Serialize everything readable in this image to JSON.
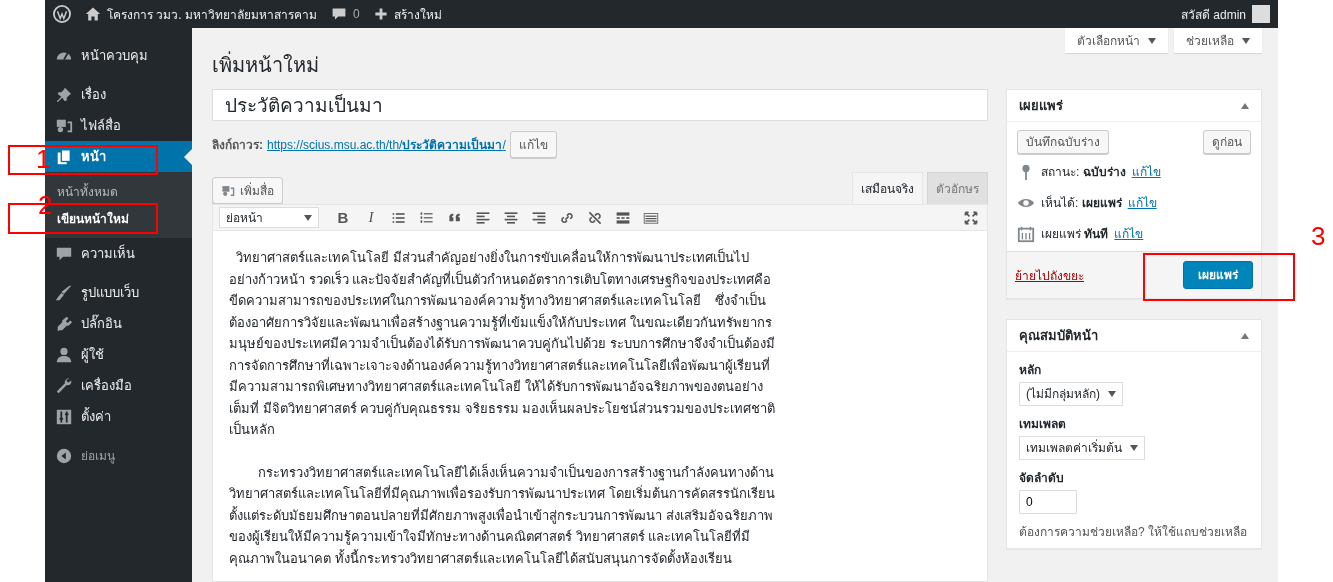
{
  "admin_bar": {
    "site_name": "โครงการ วมว. มหาวิทยาลัยมหาสารคาม",
    "comments": "0",
    "new_label": "สร้างใหม่",
    "greeting": "สวัสดี admin"
  },
  "sidebar": {
    "groups": [
      {
        "items": [
          {
            "kind": "dashboard",
            "label": "หน้าควบคุม",
            "selected": false
          }
        ]
      },
      {
        "items": [
          {
            "kind": "posts",
            "label": "เรื่อง",
            "selected": false
          },
          {
            "kind": "media",
            "label": "ไฟล์สื่อ",
            "selected": false
          },
          {
            "kind": "pages",
            "label": "หน้า",
            "selected": true,
            "children": [
              {
                "label": "หน้าทั้งหมด",
                "selected": false
              },
              {
                "label": "เขียนหน้าใหม่",
                "selected": true
              }
            ]
          },
          {
            "kind": "comments",
            "label": "ความเห็น",
            "selected": false
          }
        ]
      },
      {
        "items": [
          {
            "kind": "appearance",
            "label": "รูปแบบเว็บ",
            "selected": false
          },
          {
            "kind": "plugins",
            "label": "ปลั๊กอิน",
            "selected": false
          },
          {
            "kind": "users",
            "label": "ผู้ใช้",
            "selected": false
          },
          {
            "kind": "tools",
            "label": "เครื่องมือ",
            "selected": false
          },
          {
            "kind": "settings",
            "label": "ตั้งค่า",
            "selected": false
          }
        ]
      }
    ],
    "collapse": {
      "label": "ย่อเมนู"
    }
  },
  "screen_meta": [
    {
      "label": "ตัวเลือกหน้า"
    },
    {
      "label": "ช่วยเหลือ"
    }
  ],
  "page_title": "เพิ่มหน้าใหม่",
  "post_title": {
    "value": "ประวัติความเป็นมา"
  },
  "permalink": {
    "label": "ลิงก์ถาวร:",
    "url": "https://scius.msu.ac.th/th/**ประวัติความเป็นมา**/",
    "edit_button": "แก้ไข"
  },
  "add_media": "เพิ่มสื่อ",
  "editor_tabs": [
    {
      "label": "เสมือนจริง",
      "selected": true
    },
    {
      "label": "ตัวอักษร",
      "selected": false
    }
  ],
  "toolbar": {
    "format": "ย่อหน้า",
    "bold_glyph": "B",
    "italic_glyph": "I"
  },
  "content": [
    {
      "lines": [
        "  วิทยาศาสตร์และเทคโนโลยี มีส่วนสำคัญอย่างยิ่งในการขับเคลื่อนให้การพัฒนาประเทศเป็นไป",
        "อย่างก้าวหน้า รวดเร็ว และปัจจัยสำคัญที่เป็นตัวกำหนดอัตราการเติบโตทางเศรษฐกิจของประเทศคือ",
        "ขีดความสามารถของประเทศในการพัฒนาองค์ความรู้ทางวิทยาศาสตร์และเทคโนโลยี    ซึ่งจำเป็น",
        "ต้องอาศัยการวิจัยและพัฒนาเพื่อสร้างฐานความรู้ที่เข้มแข็งให้กับประเทศ ในขณะเดียวกันทรัพยากร",
        "มนุษย์ของประเทศมีความจำเป็นต้องได้รับการพัฒนาควบคู่กันไปด้วย ระบบการศึกษาจึงจำเป็นต้องมี",
        "การจัดการศึกษาที่เฉพาะเจาะจงด้านองค์ความรู้ทางวิทยาศาสตร์และเทคโนโลยีเพื่อพัฒนาผู้เรียนที่",
        "มีความสามารถพิเศษทางวิทยาศาสตร์และเทคโนโลยี ให้ได้รับการพัฒนาอัจฉริยภาพของตนอย่าง",
        "เต็มที่ มีจิตวิทยาศาสตร์ ควบคู่กับคุณธรรม จริยธรรม มองเห็นผลประโยชน์ส่วนรวมของประเทศชาติ",
        "เป็นหลัก"
      ]
    },
    {
      "lines": [
        "        กระทรวงวิทยาศาสตร์และเทคโนโลยีได้เล็งเห็นความจำเป็นของการสร้างฐานกำลังคนทางด้าน",
        "วิทยาศาสตร์และเทคโนโลยีที่มีคุณภาพเพื่อรองรับการพัฒนาประเทศ โดยเริ่มต้นการคัดสรรนักเรียน",
        "ตั้งแต่ระดับมัธยมศึกษาตอนปลายที่มีศักยภาพสูงเพื่อนำเข้าสู่กระบวนการพัฒนา ส่งเสริมอัจฉริยภาพ",
        "ของผู้เรียนให้มีความรู้ความเข้าใจมีทักษะทางด้านคณิตศาสตร์ วิทยาศาสตร์ และเทคโนโลยีที่มี",
        "คุณภาพในอนาคต ทั้งนี้กระทรวงวิทยาศาสตร์และเทคโนโลยีได้สนับสนุนการจัดตั้งห้องเรียน"
      ]
    }
  ],
  "publish_box": {
    "title": "เผยแพร่",
    "save_draft": "บันทึกฉบับร่าง",
    "preview": "ดูก่อน",
    "rows": [
      {
        "kind": "status",
        "text": "สถานะ: **ฉบับร่าง**",
        "link": "แก้ไข"
      },
      {
        "kind": "visibility",
        "text": "เห็นได้: **เผยแพร่**",
        "link": "แก้ไข"
      },
      {
        "kind": "schedule",
        "text": "เผยแพร่ **ทันที**",
        "link": "แก้ไข"
      }
    ],
    "trash": "ย้ายไปถังขยะ",
    "publish": "เผยแพร่"
  },
  "attributes_box": {
    "title": "คุณสมบัติหน้า",
    "parent_label": "หลัก",
    "parent_value": "(ไม่มีกลุ่มหลัก)",
    "template_label": "เทมเพลต",
    "template_value": "เทมเพลตค่าเริ่มต้น",
    "order_label": "จัดลำดับ",
    "order_value": "0",
    "help": "ต้องการความช่วยเหลือ? ให้ใช้แถบช่วยเหลือ"
  },
  "annotations": [
    {
      "label": "1"
    },
    {
      "label": "2"
    },
    {
      "label": "3"
    }
  ]
}
